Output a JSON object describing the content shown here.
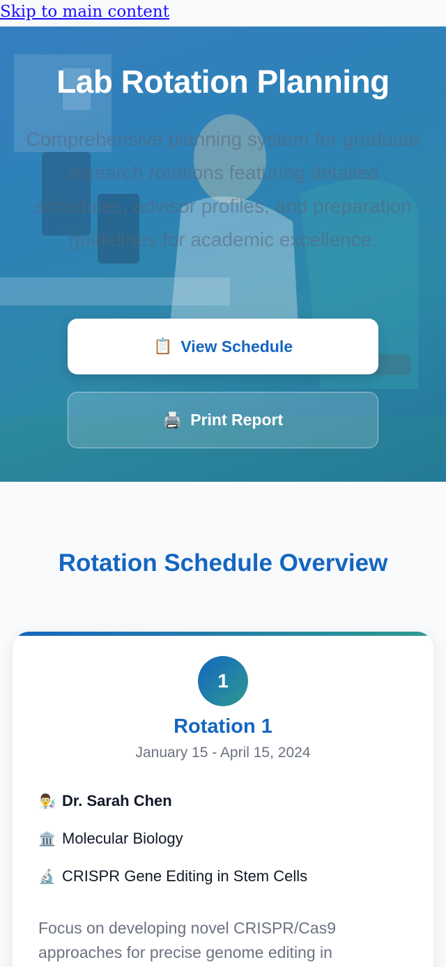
{
  "skip_link": "Skip to main content",
  "hero": {
    "title": "Lab Rotation Planning",
    "subtitle": "Comprehensive planning system for graduate research rotations featuring detailed schedules, advisor profiles, and preparation guidelines for academic excellence.",
    "primary_button": {
      "icon": "📋",
      "label": "View Schedule"
    },
    "secondary_button": {
      "icon": "🖨️",
      "label": "Print Report"
    }
  },
  "schedule": {
    "title": "Rotation Schedule Overview",
    "rotations": [
      {
        "number": "1",
        "title": "Rotation 1",
        "dates": "January 15 - April 15, 2024",
        "advisor_icon": "👨‍🔬",
        "advisor": "Dr. Sarah Chen",
        "department_icon": "🏛️",
        "department": "Molecular Biology",
        "project_icon": "🔬",
        "project": "CRISPR Gene Editing in Stem Cells",
        "description": "Focus on developing novel CRISPR/Cas9 approaches for precise genome editing in"
      }
    ]
  },
  "colors": {
    "brand_blue": "#1565c0",
    "teal": "#2e9a8f",
    "muted_text": "#6b7280"
  }
}
